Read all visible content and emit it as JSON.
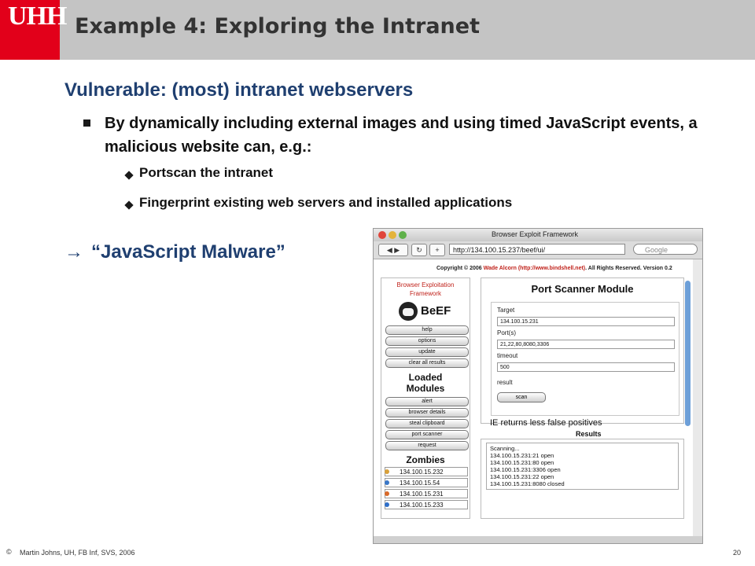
{
  "header": {
    "logo_text": "UHH",
    "title": "Example 4: Exploring the Intranet"
  },
  "body": {
    "subtitle": "Vulnerable: (most) intranet webservers",
    "bullet": "By dynamically including external images and using timed JavaScript events, a malicious website can, e.g.:",
    "sub_bullets": [
      "Portscan the intranet",
      "Fingerprint existing web servers and installed applications"
    ],
    "arrow_glyph": "→",
    "arrow_text": "“JavaScript Malware”"
  },
  "footer": {
    "copyright_symbol": "©",
    "text": "Martin Johns, UH, FB Inf, SVS, 2006",
    "page": "20"
  },
  "browser": {
    "window_title": "Browser Exploit Framework",
    "back_label": "◀ ▶",
    "reload_label": "↻",
    "add_label": "+",
    "url": "http://134.100.15.237/beef/ui/",
    "search_placeholder": "Google",
    "copyright": {
      "prefix": "Copyright © 2006",
      "author": "Wade Alcorn",
      "link": "(http://www.bindshell.net)",
      "suffix": ". All Rights Reserved. Version 0.2"
    },
    "beef": {
      "name_line1": "Browser Exploitation",
      "name_line2": "Framework",
      "logo_text": "BeEF",
      "menu_buttons": [
        "help",
        "options",
        "update",
        "clear all results"
      ],
      "loaded_modules_line1": "Loaded",
      "loaded_modules_line2": "Modules",
      "modules": [
        "alert",
        "browser details",
        "steal clipboard",
        "port scanner",
        "request"
      ],
      "zombies_heading": "Zombies",
      "zombies": [
        "134.100.15.232",
        "134.100.15.54",
        "134.100.15.231",
        "134.100.15.233"
      ]
    },
    "port_scanner": {
      "title": "Port Scanner Module",
      "target_label": "Target",
      "target_value": "134.100.15.231",
      "ports_label": "Port(s)",
      "ports_value": "21,22,80,8080,3306",
      "timeout_label": "timeout",
      "timeout_value": "500",
      "result_label": "result",
      "scan_label": "scan",
      "note": "IE returns less false positives",
      "results_heading": "Results",
      "results": [
        "Scanning...",
        "134.100.15.231:21 open",
        "134.100.15.231:80 open",
        "134.100.15.231:3306 open",
        "134.100.15.231:22 open",
        "134.100.15.231:8080 closed"
      ]
    }
  }
}
